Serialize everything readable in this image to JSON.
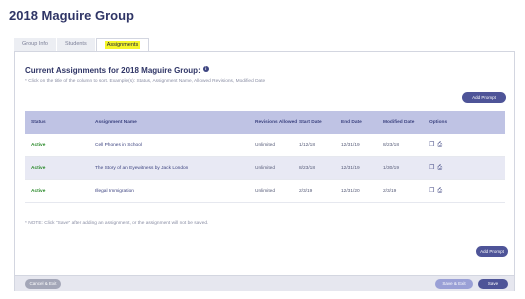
{
  "page": {
    "title": "2018 Maguire Group"
  },
  "tabs": [
    {
      "label": "Group Info"
    },
    {
      "label": "Students"
    },
    {
      "label": "Assignments"
    }
  ],
  "main": {
    "heading": "Current Assignments for 2018 Maguire Group:",
    "hint": "* Click on the title of the column to sort. Example(s): Status, Assignment Name, Allowed Revisions, Modified Date",
    "add_prompt_label": "Add Prompt",
    "note": "* NOTE: Click \"Save\" after adding an assignment, or the assignment will not be saved."
  },
  "table": {
    "headers": {
      "status": "Status",
      "name": "Assignment Name",
      "revisions": "Revisions Allowed",
      "start": "Start Date",
      "end": "End Date",
      "modified": "Modified Date",
      "options": "Options"
    },
    "rows": [
      {
        "status": "Active",
        "name": "Cell Phones in School",
        "revisions": "Unlimited",
        "start": "1/12/18",
        "end": "12/31/19",
        "modified": "8/23/18"
      },
      {
        "status": "Active",
        "name": "The Story of an Eyewitness by Jack London",
        "revisions": "Unlimited",
        "start": "8/23/18",
        "end": "12/31/19",
        "modified": "1/30/19"
      },
      {
        "status": "Active",
        "name": "Illegal Immigration",
        "revisions": "Unlimited",
        "start": "2/3/19",
        "end": "12/31/20",
        "modified": "2/3/19"
      }
    ]
  },
  "footer": {
    "cancel_label": "Cancel & Exit",
    "save_exit_label": "Save & Exit",
    "save_label": "Save"
  },
  "colors": {
    "accent": "#4e5498",
    "active_status": "#2a8a2a",
    "tab_highlight": "#f5f52a",
    "header_bg": "#bfc3e4"
  },
  "icons": {
    "copy": "copy-icon",
    "print": "print-icon",
    "info": "info-icon"
  }
}
